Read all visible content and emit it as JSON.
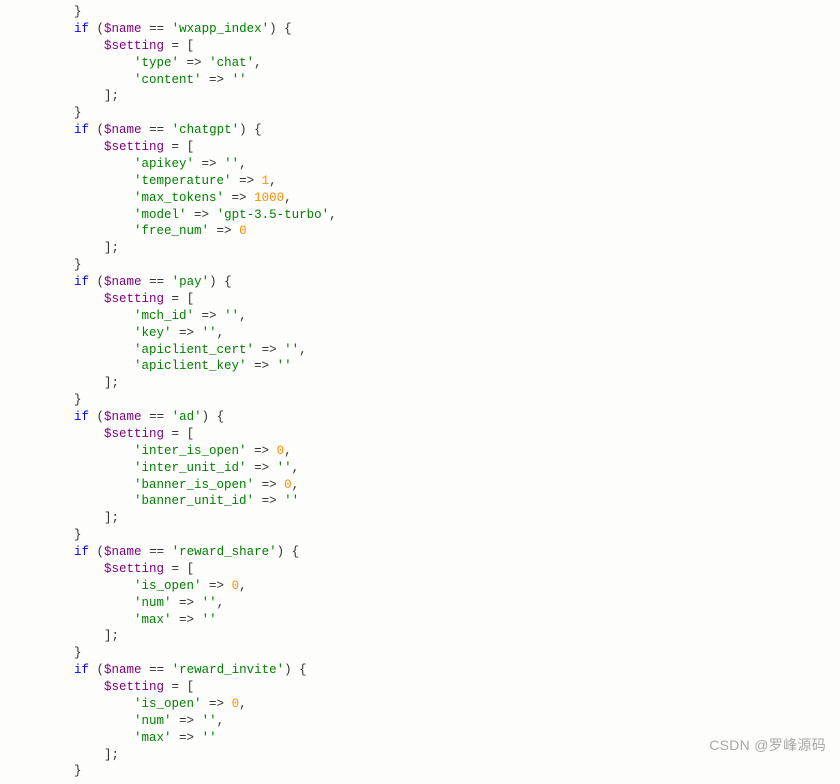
{
  "watermark": "CSDN @罗峰源码",
  "if_token": "if",
  "var_name": "$name",
  "var_setting": "$setting",
  "eq": "==",
  "arrow": "=>",
  "assign": "=",
  "open_arr": "[",
  "close_arr": "];",
  "close_blk": "}",
  "comma": ",",
  "blocks": [
    {
      "cond": "'wxapp_index'",
      "items": [
        {
          "key": "'type'",
          "val": "'chat'",
          "type": "str",
          "trail": ","
        },
        {
          "key": "'content'",
          "val": "''",
          "type": "str",
          "trail": ""
        }
      ]
    },
    {
      "cond": "'chatgpt'",
      "items": [
        {
          "key": "'apikey'",
          "val": "''",
          "type": "str",
          "trail": ","
        },
        {
          "key": "'temperature'",
          "val": "1",
          "type": "num",
          "trail": ","
        },
        {
          "key": "'max_tokens'",
          "val": "1000",
          "type": "num",
          "trail": ","
        },
        {
          "key": "'model'",
          "val": "'gpt-3.5-turbo'",
          "type": "str",
          "trail": ","
        },
        {
          "key": "'free_num'",
          "val": "0",
          "type": "num",
          "trail": ""
        }
      ]
    },
    {
      "cond": "'pay'",
      "items": [
        {
          "key": "'mch_id'",
          "val": "''",
          "type": "str",
          "trail": ","
        },
        {
          "key": "'key'",
          "val": "''",
          "type": "str",
          "trail": ","
        },
        {
          "key": "'apiclient_cert'",
          "val": "''",
          "type": "str",
          "trail": ","
        },
        {
          "key": "'apiclient_key'",
          "val": "''",
          "type": "str",
          "trail": ""
        }
      ]
    },
    {
      "cond": "'ad'",
      "items": [
        {
          "key": "'inter_is_open'",
          "val": "0",
          "type": "num",
          "trail": ","
        },
        {
          "key": "'inter_unit_id'",
          "val": "''",
          "type": "str",
          "trail": ","
        },
        {
          "key": "'banner_is_open'",
          "val": "0",
          "type": "num",
          "trail": ","
        },
        {
          "key": "'banner_unit_id'",
          "val": "''",
          "type": "str",
          "trail": ""
        }
      ]
    },
    {
      "cond": "'reward_share'",
      "items": [
        {
          "key": "'is_open'",
          "val": "0",
          "type": "num",
          "trail": ","
        },
        {
          "key": "'num'",
          "val": "''",
          "type": "str",
          "trail": ","
        },
        {
          "key": "'max'",
          "val": "''",
          "type": "str",
          "trail": ""
        }
      ]
    },
    {
      "cond": "'reward_invite'",
      "items": [
        {
          "key": "'is_open'",
          "val": "0",
          "type": "num",
          "trail": ","
        },
        {
          "key": "'num'",
          "val": "''",
          "type": "str",
          "trail": ","
        },
        {
          "key": "'max'",
          "val": "''",
          "type": "str",
          "trail": ""
        }
      ]
    }
  ]
}
